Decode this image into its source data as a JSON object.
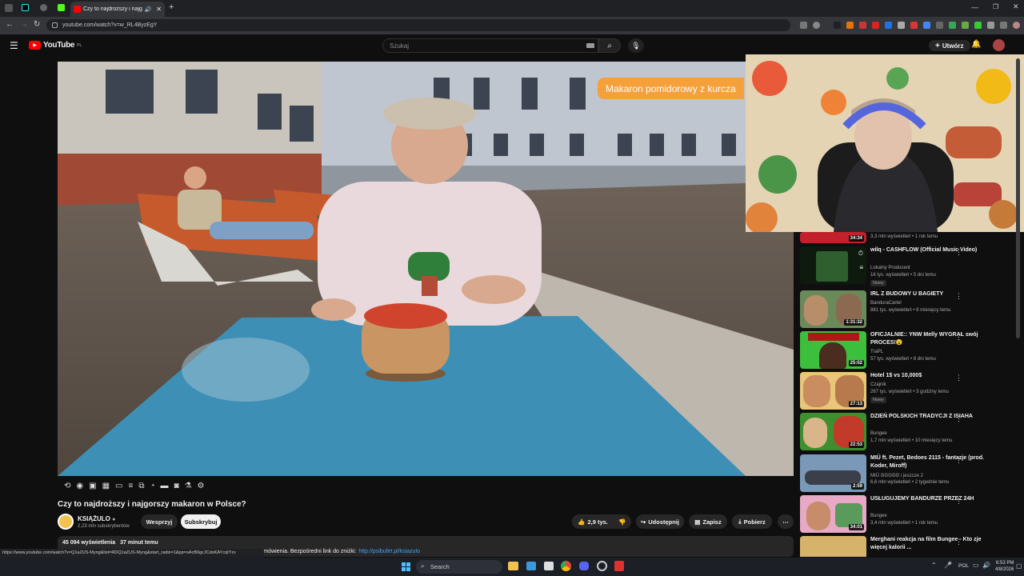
{
  "browser": {
    "tab_title": "Czy to najdroższy i najgorsz",
    "url": "youtube.com/watch?v=w_RL4ByzEgY",
    "status_url": "https://www.youtube.com/watch?v=Q1aZUS-Myng&list=RDQ1aZUS-Myng&start_radio=1&pp=oAcB0gcJCdoKAYcqIYzv"
  },
  "header": {
    "logo": "YouTube",
    "logo_region": "PL",
    "search_placeholder": "Szukaj",
    "create_label": "Utwórz"
  },
  "video": {
    "overlay_text": "Makaron pomidorowy z kurcza",
    "title": "Czy to najdroższy i najgorszy makaron w Polsce?",
    "channel": "KSIĄŻULO",
    "subscribers": "2,23 mln subskrybentów",
    "support_label": "Wesprzyj",
    "subscribe_label": "Subskrybuj",
    "likes": "2,9 tys.",
    "share_label": "Udostępnij",
    "save_label": "Zapisz",
    "download_label": "Pobierz",
    "views": "45 094 wyświetlenia",
    "posted": "37 minut temu",
    "desc_snippet": "zamówienia. Bezpośredni link do zniżki:",
    "desc_link": "http://psibufet.pl/ksiazulo"
  },
  "recommendations": [
    {
      "title": "",
      "channel": "",
      "meta": "3,3 mln wyświetleń • 1 rok temu",
      "duration": "34:34"
    },
    {
      "title": "wilq - CASHFLOW (Official Music Video)",
      "channel": "Lokalny Producent",
      "meta": "16 tys. wyświetleń • 5 dni temu",
      "badge": "Nowy",
      "duration": ""
    },
    {
      "title": "IRL Z BUDOWY U BAGIETY",
      "channel": "BanduraCartel",
      "meta": "881 tys. wyświetleń • 8 miesięcy temu",
      "duration": "1:31:32"
    },
    {
      "title": "OFICJALNIE:: YNW Melly WYGRAŁ swój PROCES!😮",
      "channel": "TraPL",
      "meta": "57 tys. wyświetleń • 8 dni temu",
      "duration": "25:02"
    },
    {
      "title": "Hotel 1$ vs 10,000$",
      "channel": "Czajnik",
      "meta": "267 tys. wyświetleń • 3 godziny temu",
      "badge": "Nowy",
      "duration": "27:13"
    },
    {
      "title": "DZIEŃ POLSKICH TRADYCJI Z ISIAHA",
      "channel": "Bungee",
      "meta": "1,7 mln wyświetleń • 10 miesięcy temu",
      "duration": "22:53"
    },
    {
      "title": "MIÜ ft. Pezet, Bedoes 2115 - fantazje (prod. Koder, Miroff)",
      "channel": "MIÜ 𝕆𝕆𝕆𝕆𝕆 i jeszcze 2",
      "meta": "6,6 mln wyświetleń • 2 tygodnie temu",
      "duration": "2:59"
    },
    {
      "title": "USŁUGUJEMY BANDURZE PRZEZ 24H",
      "channel": "Bungee",
      "meta": "3,4 mln wyświetleń • 1 rok temu",
      "duration": "34:01"
    },
    {
      "title": "Merghani reakcja na film Bungee - Kto zje więcej kalorii ...",
      "channel": "",
      "meta": "",
      "duration": ""
    }
  ],
  "taskbar": {
    "search_label": "Search",
    "lang": "POL",
    "time": "6:53 PM",
    "date": "4/8/2026"
  },
  "colors": {
    "yt_red": "#ff0000",
    "overlay_orange": "#f5a03a",
    "link_blue": "#3ea6ff",
    "table_blue": "#3d8fb6"
  }
}
